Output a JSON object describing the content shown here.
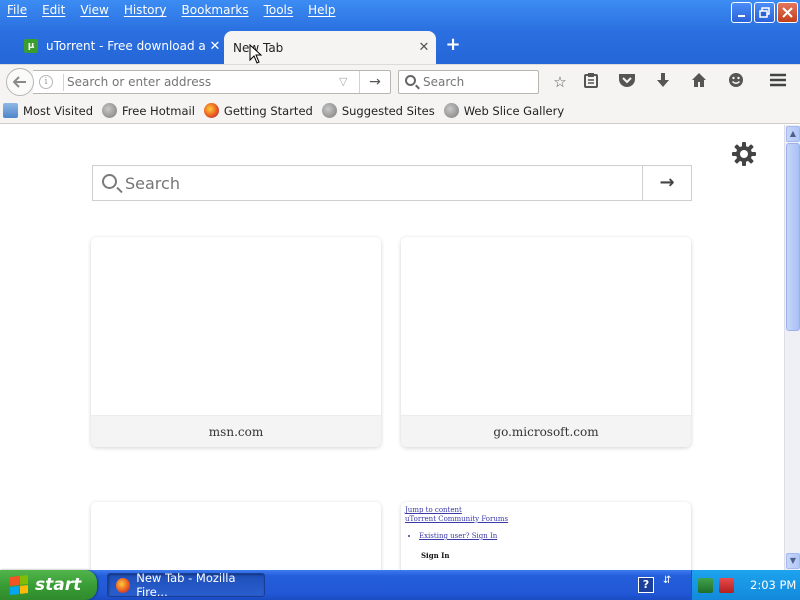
{
  "menubar": {
    "items": [
      "File",
      "Edit",
      "View",
      "History",
      "Bookmarks",
      "Tools",
      "Help"
    ]
  },
  "tabs": [
    {
      "title": "uTorrent - Free download an...",
      "active": false,
      "favicon": "utorrent-icon"
    },
    {
      "title": "New Tab",
      "active": true
    }
  ],
  "navbar": {
    "url_placeholder": "Search or enter address",
    "search_placeholder": "Search"
  },
  "bookmarks": [
    {
      "label": "Most Visited",
      "icon": "folder-icon"
    },
    {
      "label": "Free Hotmail",
      "icon": "globe-icon"
    },
    {
      "label": "Getting Started",
      "icon": "firefox-icon"
    },
    {
      "label": "Suggested Sites",
      "icon": "globe-icon"
    },
    {
      "label": "Web Slice Gallery",
      "icon": "globe-icon"
    }
  ],
  "newtab": {
    "search_placeholder": "Search",
    "tiles": [
      {
        "caption": "msn.com"
      },
      {
        "caption": "go.microsoft.com"
      },
      {
        "caption": ""
      },
      {
        "caption": ""
      }
    ],
    "preview": {
      "line1": "Jump to content",
      "line2": "uTorrent Community Forums",
      "item": "Existing user? Sign In",
      "heading": "Sign In"
    }
  },
  "taskbar": {
    "start_label": "start",
    "task_item": "New Tab - Mozilla Fire...",
    "clock": "2:03 PM"
  },
  "colors": {
    "titlebar": "#2a6fe0",
    "start_green": "#3a9d36",
    "tray_blue": "#1389db"
  }
}
